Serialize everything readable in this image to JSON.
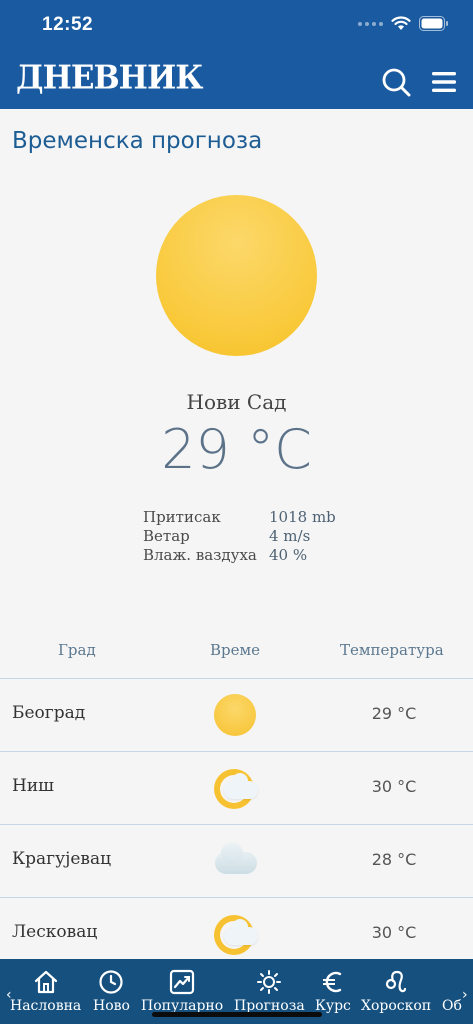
{
  "status_bar": {
    "time": "12:52"
  },
  "header": {
    "logo": "ДНЕВНИК"
  },
  "page_title": "Временска прогноза",
  "current": {
    "city": "Нови Сад",
    "temperature": "29 °C",
    "stats": [
      {
        "label": "Притисак",
        "value": "1018 mb"
      },
      {
        "label": "Ветар",
        "value": "4 m/s"
      },
      {
        "label": "Влаж. ваздуха",
        "value": "40 %"
      }
    ]
  },
  "table": {
    "headers": {
      "city": "Град",
      "weather": "Време",
      "temperature": "Температура"
    },
    "rows": [
      {
        "city": "Београд",
        "icon": "sun-icon",
        "temperature": "29 °C"
      },
      {
        "city": "Ниш",
        "icon": "sun-cloud-icon",
        "temperature": "30 °C"
      },
      {
        "city": "Крагујевац",
        "icon": "cloud-icon",
        "temperature": "28 °C"
      },
      {
        "city": "Лесковац",
        "icon": "sun-cloud-icon",
        "temperature": "30 °C"
      }
    ]
  },
  "tabs": [
    {
      "label": "Насловна",
      "icon": "home-icon"
    },
    {
      "label": "Ново",
      "icon": "clock-icon"
    },
    {
      "label": "Популарно",
      "icon": "trending-icon"
    },
    {
      "label": "Прогноза",
      "icon": "sun-outline-icon"
    },
    {
      "label": "Курс",
      "icon": "euro-icon"
    },
    {
      "label": "Хороскоп",
      "icon": "leo-icon"
    },
    {
      "label": "Об",
      "icon": ""
    }
  ],
  "colors": {
    "brand": "#1a5aa0",
    "tab_bar": "#16507f",
    "title": "#1d5d94",
    "sun": "#f9c93a"
  }
}
